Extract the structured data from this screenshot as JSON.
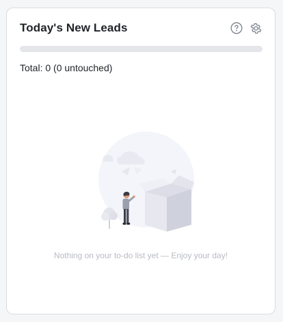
{
  "card": {
    "title": "Today's New Leads",
    "help_icon": "question-circle-icon",
    "settings_icon": "gear-icon",
    "progress_value": 0,
    "total_text": "Total: 0 (0 untouched)",
    "empty_message": "Nothing on your to-do list yet — Enjoy your day!"
  },
  "colors": {
    "title": "#1f2329",
    "icon": "#7a7f88",
    "progress_track": "#e4e6ea",
    "empty_text": "#b7bbc2"
  }
}
